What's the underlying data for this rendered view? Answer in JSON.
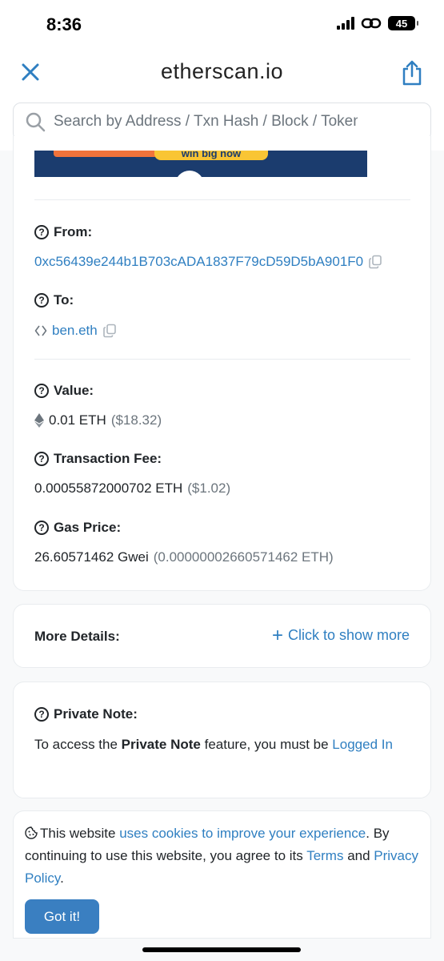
{
  "status_bar": {
    "time": "8:36",
    "battery": "45"
  },
  "browser": {
    "site_title": "etherscan.io"
  },
  "search": {
    "placeholder": "Search by Address / Txn Hash / Block / Token"
  },
  "ad": {
    "cta_text": "win big now"
  },
  "transaction": {
    "from_label": "From:",
    "from_address": "0xc56439e244b1B703cADA1837F79cD59D5bA901F0",
    "to_label": "To:",
    "to_name": "ben.eth",
    "value_label": "Value:",
    "value_eth": "0.01 ETH",
    "value_usd": "($18.32)",
    "fee_label": "Transaction Fee:",
    "fee_eth": "0.00055872000702 ETH",
    "fee_usd": "($1.02)",
    "gas_label": "Gas Price:",
    "gas_gwei": "26.60571462 Gwei",
    "gas_eth": "(0.00000002660571462 ETH)"
  },
  "more_details": {
    "label": "More Details:",
    "action": "Click to show more"
  },
  "private_note": {
    "label": "Private Note:",
    "text_prefix": "To access the ",
    "text_bold": "Private Note",
    "text_middle": " feature, you must be ",
    "login_link": "Logged In"
  },
  "cookie_banner": {
    "text_1": "This website ",
    "link_1": "uses cookies to improve your experience",
    "text_2": ". By continuing to use this website, you agree to its ",
    "link_2": "Terms",
    "text_3": " and ",
    "link_3": "Privacy Policy",
    "text_4": ".",
    "button": "Got it!"
  },
  "colors": {
    "link": "#2f7fc1",
    "button": "#3a7fc1",
    "text": "#212529",
    "muted": "#6c757d"
  }
}
